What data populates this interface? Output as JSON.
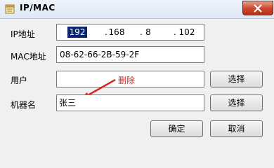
{
  "window": {
    "title": "IP/MAC",
    "close_label": "close"
  },
  "form": {
    "ip_label": "IP地址",
    "ip_octets": [
      "192",
      "168",
      "8",
      "102"
    ],
    "ip_separator": ".",
    "mac_label": "MAC地址",
    "mac_value": "08-62-66-2B-59-2F",
    "user_label": "用户",
    "user_value": "",
    "user_select_label": "选择",
    "machine_label": "机器名",
    "machine_value": "张三",
    "machine_select_label": "选择"
  },
  "annotation": {
    "text": "删除",
    "color": "#d8261f"
  },
  "footer": {
    "ok_label": "确定",
    "cancel_label": "取消"
  },
  "colors": {
    "selection_bg": "#0b2471",
    "close_red": "#c9452b"
  },
  "icons": {
    "app": "notepad-icon",
    "close": "close-icon"
  }
}
